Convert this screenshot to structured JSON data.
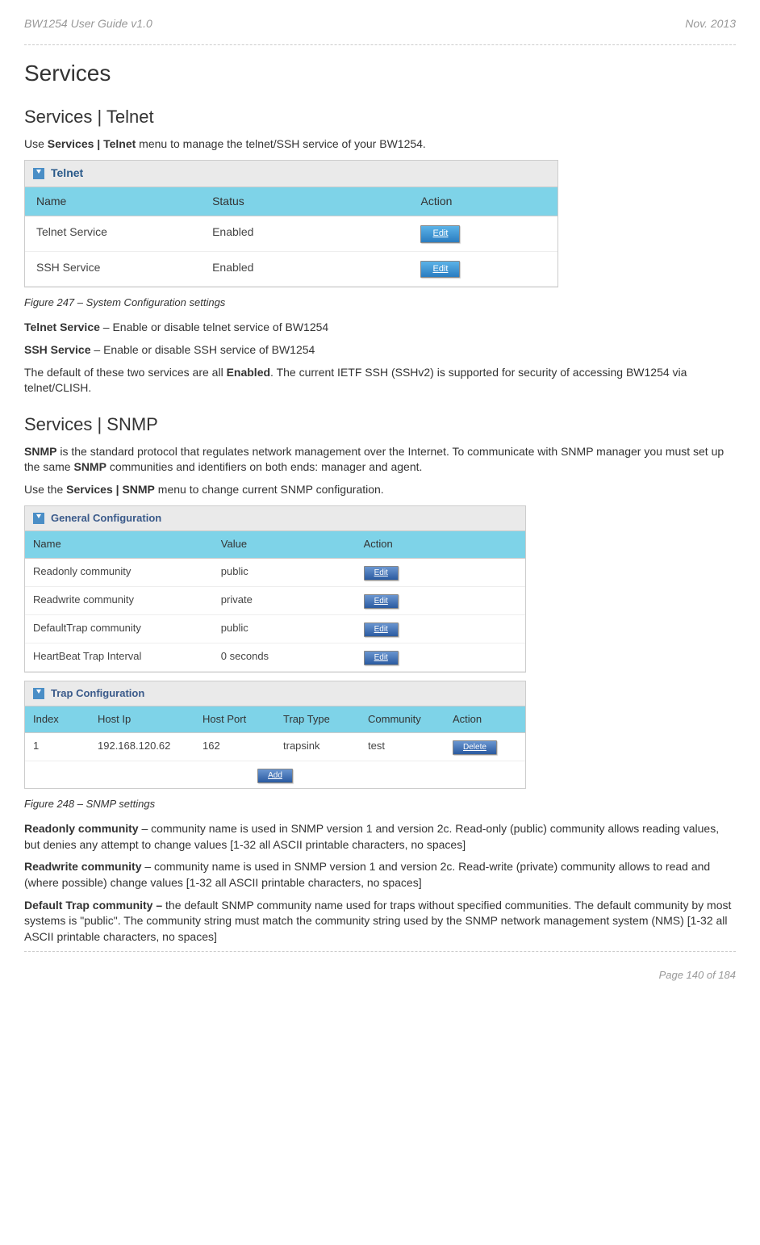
{
  "header": {
    "left": "BW1254 User Guide v1.0",
    "right": "Nov.  2013"
  },
  "title": "Services",
  "section1": {
    "title": "Services | Telnet",
    "intro_prefix": "Use ",
    "intro_bold": "Services | Telnet",
    "intro_suffix": " menu to manage the telnet/SSH service of your BW1254.",
    "table_title": "Telnet",
    "headers": {
      "c1": "Name",
      "c2": "Status",
      "c3": "Action"
    },
    "rows": [
      {
        "name": "Telnet Service",
        "status": "Enabled",
        "action": "Edit"
      },
      {
        "name": "SSH Service",
        "status": "Enabled",
        "action": "Edit"
      }
    ],
    "figure": "Figure 247 – System Configuration settings",
    "para1_bold": "Telnet Service",
    "para1_text": " – Enable or disable telnet service of BW1254",
    "para2_bold": "SSH Service",
    "para2_text": " – Enable or disable SSH service of BW1254",
    "para3_pre": "The default of these two services are all ",
    "para3_bold": "Enabled",
    "para3_post": ". The current IETF SSH (SSHv2) is supported for security of accessing BW1254 via telnet/CLISH."
  },
  "section2": {
    "title": "Services | SNMP",
    "intro1_bold": "SNMP",
    "intro1_mid": " is the standard protocol that regulates network management over the Internet. To communicate with SNMP manager you must set up the same ",
    "intro1_bold2": "SNMP",
    "intro1_end": " communities and identifiers on both ends: manager and agent.",
    "intro2_pre": "Use the ",
    "intro2_bold": "Services | SNMP",
    "intro2_post": " menu to change current SNMP configuration.",
    "gen_title": "General Configuration",
    "gen_headers": {
      "c1": "Name",
      "c2": "Value",
      "c3": "Action"
    },
    "gen_rows": [
      {
        "name": "Readonly community",
        "value": "public",
        "action": "Edit"
      },
      {
        "name": "Readwrite community",
        "value": "private",
        "action": "Edit"
      },
      {
        "name": "DefaultTrap community",
        "value": "public",
        "action": "Edit"
      },
      {
        "name": "HeartBeat Trap Interval",
        "value": "0 seconds",
        "action": "Edit"
      }
    ],
    "trap_title": "Trap Configuration",
    "trap_headers": {
      "c1": "Index",
      "c2": "Host Ip",
      "c3": "Host Port",
      "c4": "Trap Type",
      "c5": "Community",
      "c6": "Action"
    },
    "trap_rows": [
      {
        "index": "1",
        "host_ip": "192.168.120.62",
        "host_port": "162",
        "trap_type": "trapsink",
        "community": "test",
        "action": "Delete"
      }
    ],
    "add_label": "Add",
    "figure": "Figure 248 – SNMP settings",
    "para1_bold": "Readonly community",
    "para1_text": " – community name is used in SNMP version 1 and version 2c. Read-only (public) community allows reading values, but denies any attempt to change values [1-32 all ASCII printable characters, no spaces]",
    "para2_bold": "Readwrite community",
    "para2_text": " – community name is used in SNMP version 1 and version 2c. Read-write (private) community allows to read and (where possible) change values [1-32 all ASCII printable characters, no spaces]",
    "para3_bold": "Default Trap community –",
    "para3_text": " the default SNMP community name used for traps without specified communities. The default community by most systems is \"public\". The community string must match the community string used by the SNMP network management system (NMS) [1-32 all ASCII printable characters, no spaces]"
  },
  "footer": "Page 140 of 184"
}
